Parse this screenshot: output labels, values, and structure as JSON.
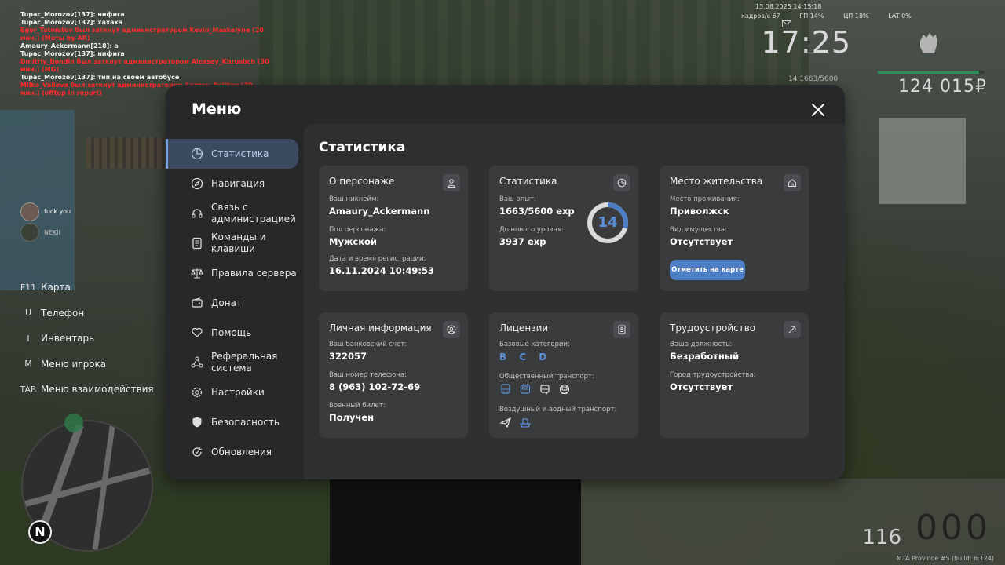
{
  "chat": [
    {
      "text": "Tupac_Morozov[137]: нифига",
      "color": "white"
    },
    {
      "text": "Tupac_Morozov[137]: хахаха",
      "color": "white"
    },
    {
      "text": "Egor_Tatmatov был заткнут администратором Kevin_Maskelyne (20 мин.) (Маты by AR)",
      "color": "red"
    },
    {
      "text": "Amaury_Ackermann[218]: а",
      "color": "white"
    },
    {
      "text": "Tupac_Morozov[137]: нифига",
      "color": "white"
    },
    {
      "text": "Dmitriy_Bondin был заткнут администратором Alexsey_Khrushch (30 мин.) (MG)",
      "color": "red"
    },
    {
      "text": "Tupac_Morozov[137]: тип на своем автобусе",
      "color": "white"
    },
    {
      "text": "Milka_Valieva был заткнут администратором Sergey_Belikov (30 мин.) (offtop in report)",
      "color": "red"
    }
  ],
  "hud": {
    "date": "13.08.2025 14:15:18",
    "fps": "кадров/с  67",
    "gp": "ГП  14%",
    "cp": "ЦП  18%",
    "lat": "LAT  0%",
    "time": "17:25",
    "level": "14   1663/5600",
    "money": "124 015₽",
    "hp_fraction": 0.95
  },
  "voice": {
    "name1": "fuck you",
    "name2": "NEKII"
  },
  "keys": [
    {
      "key": "F11",
      "label": "Карта"
    },
    {
      "key": "U",
      "label": "Телефон"
    },
    {
      "key": "I",
      "label": "Инвентарь"
    },
    {
      "key": "M",
      "label": "Меню игрока"
    },
    {
      "key": "TAB",
      "label": "Меню взаимодействия"
    }
  ],
  "minimap": {
    "north": "N"
  },
  "speedo": {
    "speed": "000",
    "fuel": "116"
  },
  "footer": "MTA Province #5 (build: 6.124)",
  "menu": {
    "title": "Меню",
    "nav": [
      {
        "label": "Статистика",
        "icon": "pie-chart-icon"
      },
      {
        "label": "Навигация",
        "icon": "compass-icon"
      },
      {
        "label": "Связь с администрацией",
        "icon": "headset-icon"
      },
      {
        "label": "Команды и клавиши",
        "icon": "document-icon"
      },
      {
        "label": "Правила сервера",
        "icon": "scales-icon"
      },
      {
        "label": "Донат",
        "icon": "wallet-icon"
      },
      {
        "label": "Помощь",
        "icon": "heart-hand-icon"
      },
      {
        "label": "Реферальная система",
        "icon": "network-icon"
      },
      {
        "label": "Настройки",
        "icon": "gear-icon"
      },
      {
        "label": "Безопасность",
        "icon": "shield-icon"
      },
      {
        "label": "Обновления",
        "icon": "refresh-icon"
      }
    ],
    "section_title": "Статистика",
    "cards": {
      "character": {
        "title": "О персонаже",
        "nick_label": "Ваш никнейм:",
        "nick": "Amaury_Ackermann",
        "gender_label": "Пол персонажа:",
        "gender": "Мужской",
        "reg_label": "Дата и время регистрации:",
        "reg": "16.11.2024 10:49:53"
      },
      "stats": {
        "title": "Статистика",
        "exp_label": "Ваш опыт:",
        "exp": "1663/5600 exp",
        "next_label": "До нового уровня:",
        "next": "3937 exp",
        "level": "14",
        "progress": 0.297
      },
      "residence": {
        "title": "Место жительства",
        "place_label": "Место проживания:",
        "place": "Приволжск",
        "property_label": "Вид имущества:",
        "property": "Отсутствует",
        "button": "Отметить на карте"
      },
      "personal": {
        "title": "Личная информация",
        "bank_label": "Ваш банковский счет:",
        "bank": "322057",
        "phone_label": "Ваш номер телефона:",
        "phone": "8 (963) 102-72-69",
        "military_label": "Военный билет:",
        "military": "Получен"
      },
      "licenses": {
        "title": "Лицензии",
        "base_label": "Базовые категории:",
        "base": "B C D",
        "public_label": "Общественный транспорт:",
        "air_label": "Воздушный и водный транспорт:"
      },
      "employment": {
        "title": "Трудоустройство",
        "position_label": "Ваша должность:",
        "position": "Безработный",
        "city_label": "Город трудоустройства:",
        "city": "Отсутствует"
      }
    }
  }
}
